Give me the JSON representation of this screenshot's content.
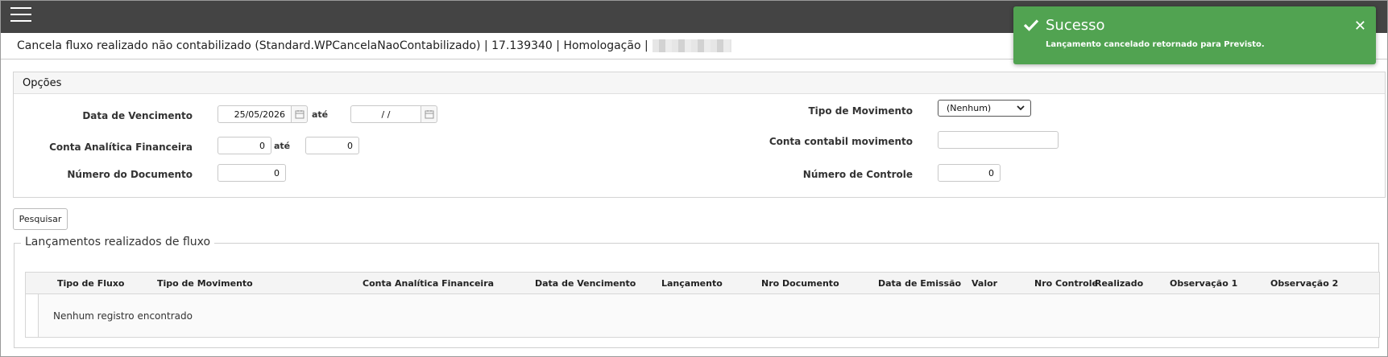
{
  "header": {
    "title": "Cancela fluxo realizado não contabilizado (Standard.WPCancelaNaoContabilizado) | 17.139340 | Homologação |"
  },
  "opcoes": {
    "title": "Opções",
    "data_vencimento_label": "Data de Vencimento",
    "data_vencimento_from": "25/05/2026",
    "data_vencimento_to": "/ /",
    "ate_label": "até",
    "conta_analitica_label": "Conta Analítica Financeira",
    "conta_analitica_from": "0",
    "conta_analitica_to": "0",
    "numero_documento_label": "Número do Documento",
    "numero_documento_value": "0",
    "tipo_movimento_label": "Tipo de Movimento",
    "tipo_movimento_selected": "(Nenhum)",
    "conta_contabil_label": "Conta contabil movimento",
    "conta_contabil_value": "",
    "numero_controle_label": "Número de Controle",
    "numero_controle_value": "0"
  },
  "search_button": "Pesquisar",
  "results": {
    "title": "Lançamentos realizados de fluxo",
    "columns": [
      "Tipo de Fluxo",
      "Tipo de Movimento",
      "Conta Analítica Financeira",
      "Data de Vencimento",
      "Lançamento",
      "Nro Documento",
      "Data de Emissão",
      "Valor",
      "Nro Controle",
      "Realizado",
      "Observação 1",
      "Observação 2"
    ],
    "empty_message": "Nenhum registro encontrado"
  },
  "toast": {
    "title": "Sucesso",
    "message": "Lançamento cancelado retornado para Previsto.",
    "color": "#51a351"
  },
  "icons": [
    "menu-icon",
    "calendar-icon",
    "check-icon",
    "close-icon",
    "chevron-down-icon"
  ]
}
